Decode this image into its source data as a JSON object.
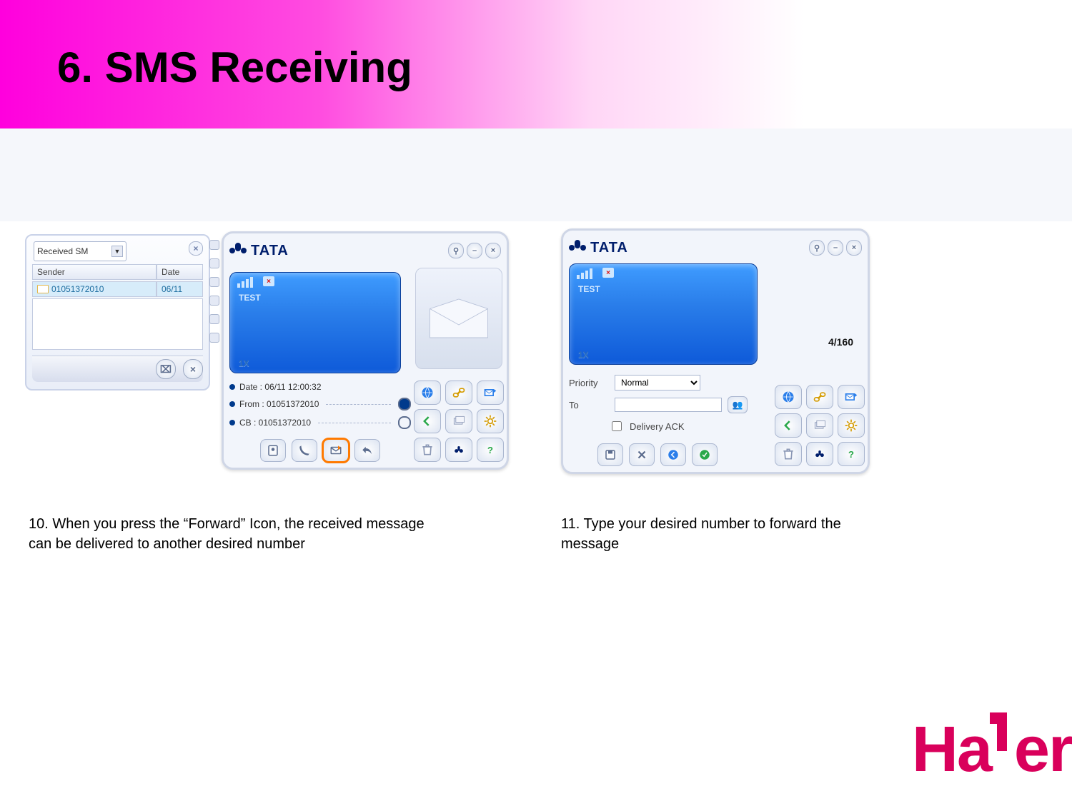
{
  "slide": {
    "title": "6. SMS Receiving",
    "captions": {
      "c1": "10. When you press the “Forward” Icon, the received message can be delivered to another desired number",
      "c2": "11. Type your desired number to forward the message"
    },
    "brand_footer": "Haier"
  },
  "listwin": {
    "dropdown_label": "Received SM",
    "header_sender": "Sender",
    "header_date": "Date",
    "rows": [
      {
        "sender": "01051372010",
        "date": "06/11"
      }
    ]
  },
  "tata": {
    "brand": "TATA",
    "message_text": "TEST",
    "onex": "1X",
    "info": {
      "date_label": "Date : 06/11 12:00:32",
      "from_label": "From : 01051372010",
      "cb_label": "CB : 01051372010"
    }
  },
  "compose": {
    "counter": "4/160",
    "priority_label": "Priority",
    "priority_value": "Normal",
    "to_label": "To",
    "to_value": "",
    "ack_label": "Delivery ACK"
  },
  "icons": {
    "contacts": "contacts",
    "phone": "phone",
    "forward": "forward",
    "reply": "reply",
    "browser": "browser",
    "chain": "chain",
    "mail": "mail",
    "back": "back",
    "cards": "cards",
    "gear": "gear",
    "trash": "trash",
    "tata": "tata",
    "help": "help",
    "save": "save",
    "cancel": "cancel",
    "prev": "prev",
    "compose": "compose"
  },
  "chart_data": null
}
